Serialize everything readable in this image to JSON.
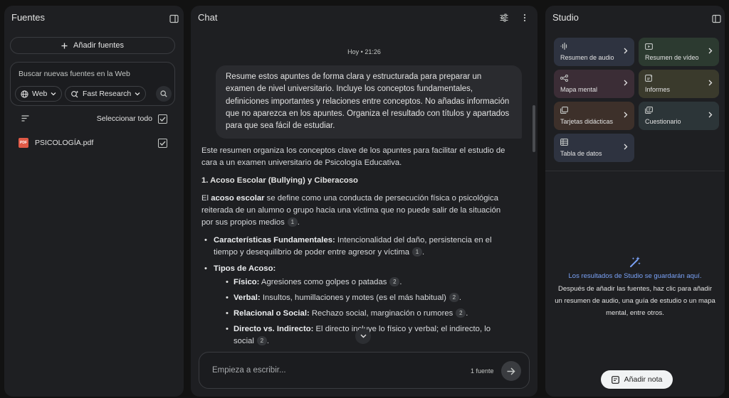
{
  "sources_panel": {
    "title": "Fuentes",
    "add_sources_label": "Añadir fuentes",
    "search_placeholder": "Buscar nuevas fuentes en la Web",
    "web_chip_label": "Web",
    "research_chip_label": "Fast Research",
    "select_all_label": "Seleccionar todo",
    "select_all_checked": true,
    "sources": [
      {
        "name": "PSICOLOGÍA.pdf",
        "type_badge": "PDF",
        "checked": true
      }
    ]
  },
  "chat_panel": {
    "title": "Chat",
    "timestamp": "Hoy • 21:26",
    "user_message": "Resume estos apuntes de forma clara y estructurada para preparar un examen de nivel universitario. Incluye los conceptos fundamentales, definiciones importantes y relaciones entre conceptos. No añadas información que no aparezca en los apuntes. Organiza el resultado con títulos y apartados para que sea fácil de estudiar.",
    "response": {
      "intro": "Este resumen organiza los conceptos clave de los apuntes para facilitar el estudio de cara a un examen universitario de Psicología Educativa.",
      "section1_title": "1. Acoso Escolar (Bullying) y Ciberacoso",
      "def_pre": "El ",
      "def_term": "acoso escolar",
      "def_rest": " se define como una conducta de persecución física o psicológica reiterada de un alumno o grupo hacia una víctima que no puede salir de la situación por sus propios medios",
      "def_cite": "1",
      "bullet1_term": "Características Fundamentales:",
      "bullet1_text": " Intencionalidad del daño, persistencia en el tiempo y desequilibrio de poder entre agresor y víctima",
      "bullet1_cite": "1",
      "bullet2_term": "Tipos de Acoso:",
      "types": [
        {
          "term": "Físico:",
          "text": " Agresiones como golpes o patadas",
          "cite": "2"
        },
        {
          "term": "Verbal:",
          "text": " Insultos, humillaciones y motes (es el más habitual)",
          "cite": "2"
        },
        {
          "term": "Relacional o Social:",
          "text": " Rechazo social, marginación o rumores",
          "cite": "2"
        },
        {
          "term": "Directo vs. Indirecto:",
          "text": " El directo incluye lo físico y verbal; el indirecto, lo social",
          "cite": "2"
        }
      ]
    },
    "composer_placeholder": "Empieza a escribir...",
    "source_count": "1 fuente"
  },
  "studio_panel": {
    "title": "Studio",
    "tools": [
      {
        "label": "Resumen de audio",
        "icon": "audio-wave-icon",
        "color": "#2e3340"
      },
      {
        "label": "Resumen de vídeo",
        "icon": "video-icon",
        "color": "#2c3a30"
      },
      {
        "label": "Mapa mental",
        "icon": "mind-map-icon",
        "color": "#3b2d36"
      },
      {
        "label": "Informes",
        "icon": "report-icon",
        "color": "#3a3a2c"
      },
      {
        "label": "Tarjetas didácticas",
        "icon": "flashcards-icon",
        "color": "#3d302a"
      },
      {
        "label": "Cuestionario",
        "icon": "quiz-icon",
        "color": "#2c3538"
      },
      {
        "label": "Tabla de datos",
        "icon": "table-icon",
        "color": "#2e3340"
      }
    ],
    "empty_title": "Los resultados de Studio se guardarán aquí.",
    "empty_desc": "Después de añadir las fuentes, haz clic para añadir un resumen de audio, una guía de estudio o un mapa mental, entre otros.",
    "add_note_label": "Añadir nota"
  }
}
